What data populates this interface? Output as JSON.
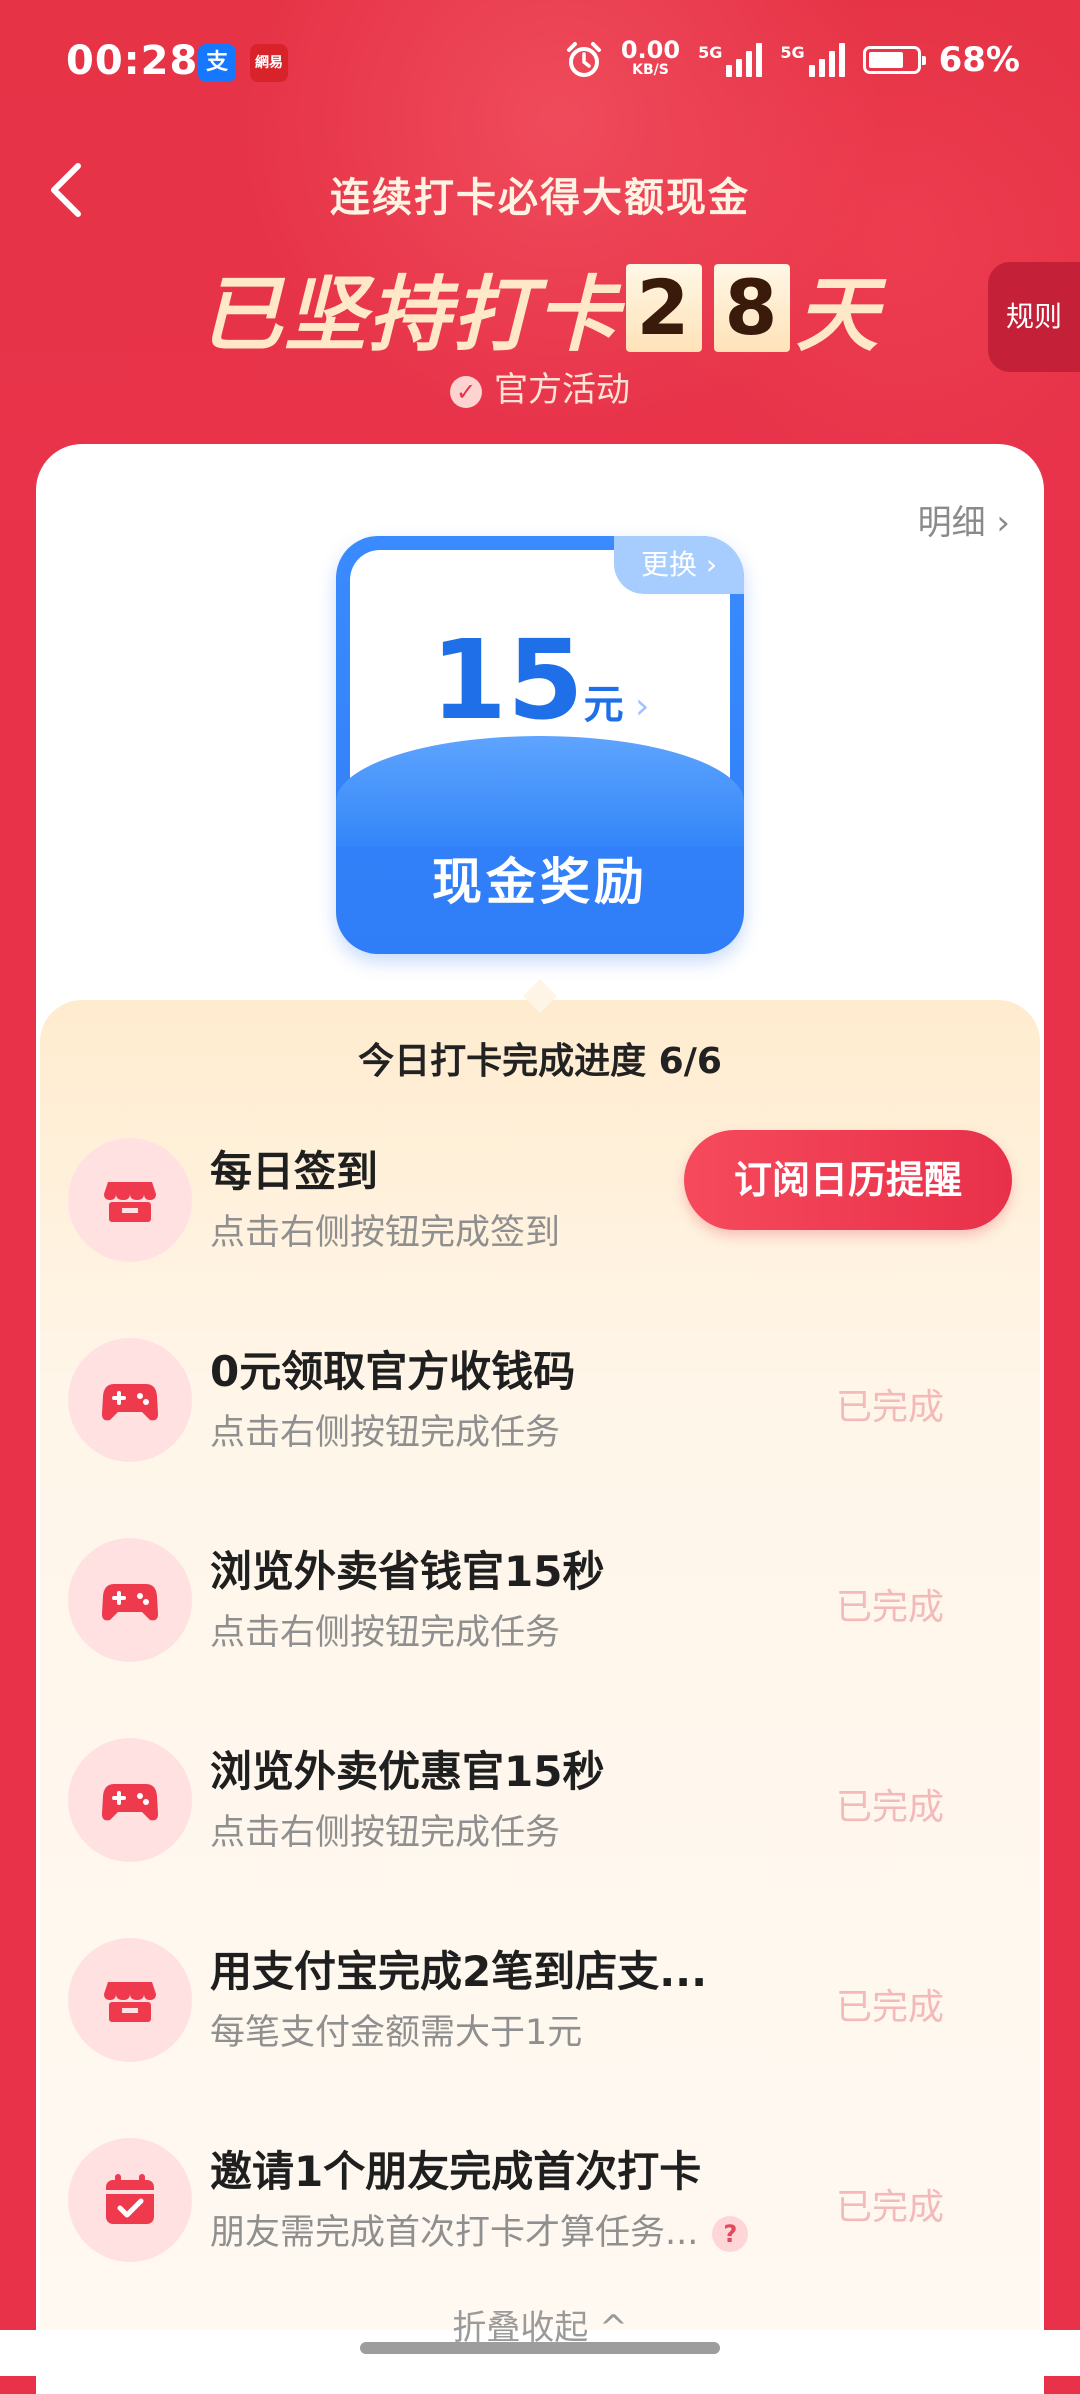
{
  "status_bar": {
    "time": "00:28",
    "app_badges": [
      "支",
      "網易"
    ],
    "net_speed_value": "0.00",
    "net_speed_unit": "KB/S",
    "sim1": "5G",
    "sim2": "5G",
    "battery": "68%"
  },
  "header": {
    "subtitle": "连续打卡必得大额现金",
    "streak_prefix": "已坚持打卡",
    "streak_digit_1": "2",
    "streak_digit_2": "8",
    "streak_suffix": "天",
    "official_label": "官方活动",
    "rules_label": "规则"
  },
  "card": {
    "details_label": "明细",
    "reward": {
      "swap_label": "更换",
      "amount": "15",
      "unit": "元",
      "label": "现金奖励"
    }
  },
  "progress": {
    "title": "今日打卡完成进度 6/6"
  },
  "tasks": [
    {
      "icon": "shop-icon",
      "title": "每日签到",
      "subtitle": "点击右侧按钮完成签到",
      "action": "订阅日历提醒"
    },
    {
      "icon": "gamepad-icon",
      "title": "0元领取官方收钱码",
      "subtitle": "点击右侧按钮完成任务",
      "status": "已完成"
    },
    {
      "icon": "gamepad-icon",
      "title": "浏览外卖省钱官15秒",
      "subtitle": "点击右侧按钮完成任务",
      "status": "已完成"
    },
    {
      "icon": "gamepad-icon",
      "title": "浏览外卖优惠官15秒",
      "subtitle": "点击右侧按钮完成任务",
      "status": "已完成"
    },
    {
      "icon": "shop-icon",
      "title": "用支付宝完成2笔到店支...",
      "subtitle": "每笔支付金额需大于1元",
      "status": "已完成"
    },
    {
      "icon": "calendar-check-icon",
      "title": "邀请1个朋友完成首次打卡",
      "subtitle": "朋友需完成首次打卡才算任务...",
      "status": "已完成",
      "help": "?"
    }
  ],
  "footer": {
    "collapse_label": "折叠收起 ^"
  }
}
